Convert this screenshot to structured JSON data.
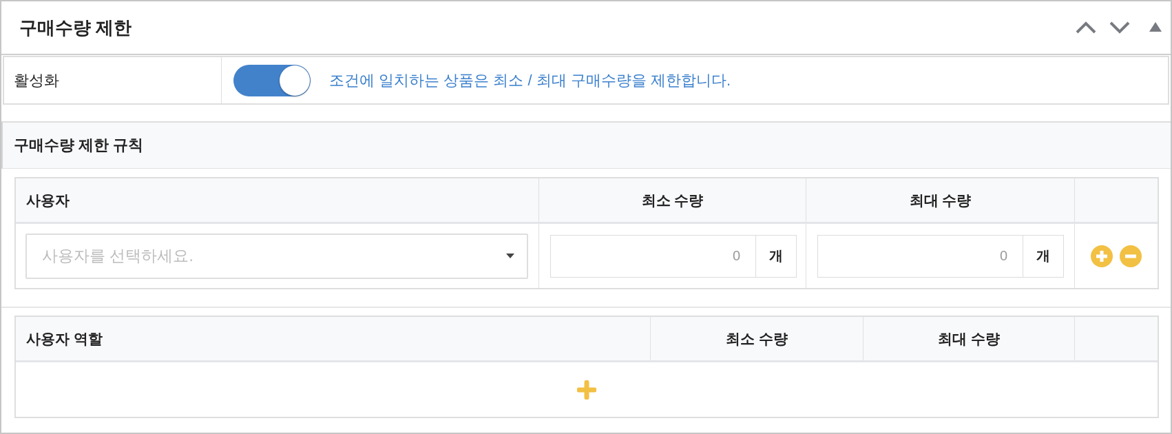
{
  "panel": {
    "title": "구매수량 제한"
  },
  "activation": {
    "label": "활성화",
    "toggle": {
      "on": true
    },
    "description": "조건에 일치하는 상품은 최소 / 최대 구매수량을 제한합니다."
  },
  "rules": {
    "title": "구매수량 제한 규칙",
    "user_table": {
      "columns": [
        "사용자",
        "최소 수량",
        "최대 수량"
      ],
      "rows": [
        {
          "user": {
            "placeholder": "사용자를 선택하세요."
          },
          "min": {
            "placeholder": "0",
            "unit": "개"
          },
          "max": {
            "placeholder": "0",
            "unit": "개"
          }
        }
      ]
    },
    "role_table": {
      "columns": [
        "사용자 역할",
        "최소 수량",
        "최대 수량"
      ]
    }
  }
}
